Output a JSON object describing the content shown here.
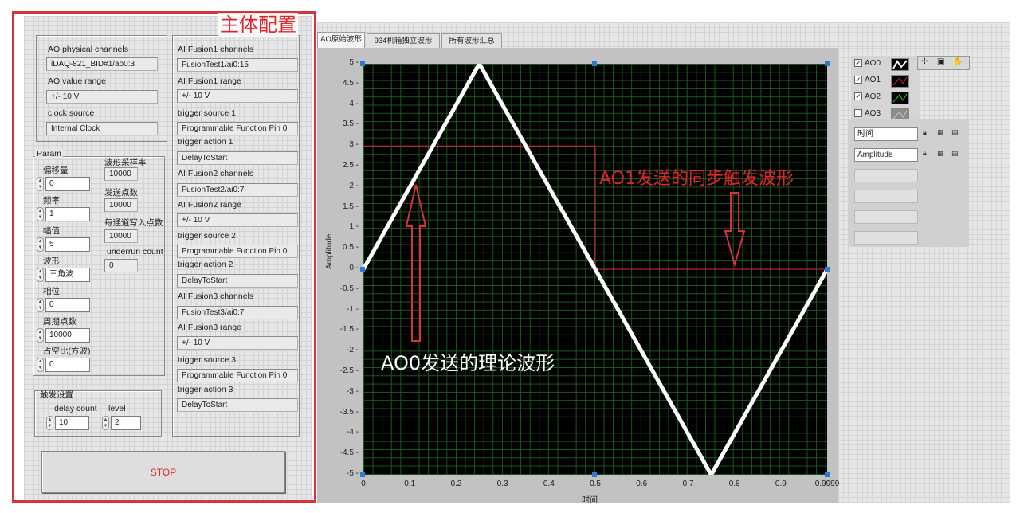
{
  "panel": {
    "title": "主体配置",
    "ao": {
      "channels_label": "AO physical channels",
      "channels_value": "iDAQ-821_BID#1/ao0:3",
      "range_label": "AO value range",
      "range_value": "+/- 10 V",
      "clock_label": "clock source",
      "clock_value": "Internal Clock"
    },
    "param": {
      "title": "Param",
      "offset_label": "偏移量",
      "offset_value": "0",
      "freq_label": "频率",
      "freq_value": "1",
      "amp_label": "幅值",
      "amp_value": "5",
      "wave_label": "波形",
      "wave_value": "三角波",
      "phase_label": "相位",
      "phase_value": "0",
      "period_label": "周期点数",
      "period_value": "10000",
      "duty_label": "占空比(方波)",
      "duty_value": "0",
      "rate_label": "波形采样率",
      "rate_value": "10000",
      "send_label": "发送点数",
      "send_value": "10000",
      "perch_label": "每通道写入点数",
      "perch_value": "10000",
      "underrun_label": "underrun count",
      "underrun_value": "0"
    },
    "trigger": {
      "title": "触发设置",
      "delay_label": "delay count",
      "delay_value": "10",
      "level_label": "level",
      "level_value": "2"
    },
    "fusion": [
      {
        "ch_label": "AI Fusion1 channels",
        "ch_value": "FusionTest1/ai0:15",
        "range_label": "AI Fusion1 range",
        "range_value": "+/- 10 V",
        "src_label": "trigger source 1",
        "src_value": "Programmable Function Pin 0",
        "act_label": "trigger action 1",
        "act_value": "DelayToStart"
      },
      {
        "ch_label": "AI Fusion2 channels",
        "ch_value": "FusionTest2/ai0:7",
        "range_label": "AI Fusion2 range",
        "range_value": "+/- 10 V",
        "src_label": "trigger source 2",
        "src_value": "Programmable Function Pin 0",
        "act_label": "trigger action 2",
        "act_value": "DelayToStart"
      },
      {
        "ch_label": "AI Fusion3 channels",
        "ch_value": "FusionTest3/ai0:7",
        "range_label": "AI Fusion3 range",
        "range_value": "+/- 10 V",
        "src_label": "trigger source 3",
        "src_value": "Programmable Function Pin 0",
        "act_label": "trigger action 3",
        "act_value": "DelayToStart"
      }
    ],
    "stop_label": "STOP"
  },
  "tabs": [
    "AO原始波形",
    "934机箱独立波形",
    "所有波形汇总"
  ],
  "graph": {
    "legend": [
      {
        "name": "AO0",
        "checked": true,
        "color": "#ffffff"
      },
      {
        "name": "AO1",
        "checked": true,
        "color": "#e0242c"
      },
      {
        "name": "AO2",
        "checked": true,
        "color": "#2ecc40"
      },
      {
        "name": "AO3",
        "checked": false,
        "color": "#9a9a9a"
      }
    ],
    "scale_x_name": "时间",
    "scale_y_name": "Amplitude",
    "annotations": {
      "ao1": "AO1发送的同步触发波形",
      "ao0": "AO0发送的理论波形"
    }
  },
  "chart_data": {
    "type": "line",
    "xlabel": "时间",
    "ylabel": "Amplitude",
    "xlim": [
      0,
      0.9999
    ],
    "ylim": [
      -5,
      5
    ],
    "x_ticks": [
      "0",
      "0.1",
      "0.2",
      "0.3",
      "0.4",
      "0.5",
      "0.6",
      "0.7",
      "0.8",
      "0.9",
      "0.9999"
    ],
    "y_ticks": [
      "5",
      "4.5",
      "4",
      "3.5",
      "3",
      "2.5",
      "2",
      "1.5",
      "1",
      "0.5",
      "0",
      "-0.5",
      "-1",
      "-1.5",
      "-2",
      "-2.5",
      "-3",
      "-3.5",
      "-4",
      "-4.5",
      "-5"
    ],
    "series": [
      {
        "name": "AO0",
        "color": "#ffffff",
        "x": [
          0,
          0.25,
          0.75,
          0.9999
        ],
        "y": [
          0,
          5,
          -5,
          0
        ]
      },
      {
        "name": "AO1",
        "color": "#e0242c",
        "x": [
          0,
          0.5,
          0.5,
          0.9999
        ],
        "y": [
          3,
          3,
          0,
          0
        ]
      }
    ],
    "grid": true
  }
}
